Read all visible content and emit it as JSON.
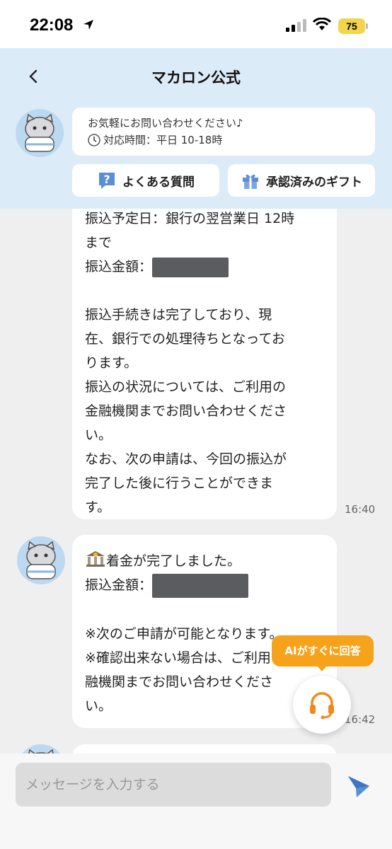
{
  "status_bar": {
    "time": "22:08",
    "battery": "75"
  },
  "header": {
    "title": "マカロン公式",
    "notice_line1": "お気軽にお問い合わせください♪",
    "notice_line2": "対応時間：平日 10-18時",
    "faq_label": "よくある質問",
    "gift_label": "承認済みのギフト"
  },
  "messages": [
    {
      "lines": [
        "振込予定日：銀行の翌営業日 12時",
        "まで",
        "振込金額："
      ],
      "body": [
        "振込手続きは完了しており、現",
        "在、銀行での処理待ちとなってお",
        "ります。",
        "振込の状況については、ご利用の",
        "金融機関までお問い合わせくださ",
        "い。",
        "なお、次の申請は、今回の振込が",
        "完了した後に行うことができま",
        "す。"
      ],
      "time": "16:40"
    },
    {
      "line1": "着金が完了しました。",
      "line2": "振込金額：",
      "body": [
        "※次のご申請が可能となります。",
        "※確認出来ない場合は、ご利用の金",
        "融機関までお問い合わせくださ",
        "い。"
      ],
      "time": "16:42"
    }
  ],
  "ai_badge": "AIがすぐに回答",
  "input": {
    "placeholder": "メッセージを入力する"
  },
  "icons": {
    "back": "chevron-left-icon",
    "clock": "clock-icon",
    "faq": "question-icon",
    "gift": "gift-icon",
    "support": "headset-icon",
    "send": "send-icon"
  },
  "colors": {
    "header_bg": "#dcebf8",
    "accent": "#f7a21b",
    "send": "#5a8fd6",
    "avatar_bg": "#bcd9f2"
  }
}
